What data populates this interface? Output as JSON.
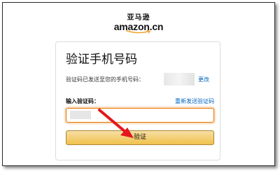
{
  "logo": {
    "cn": "亚马逊",
    "en": "amazon.cn"
  },
  "card": {
    "title": "验证手机号码",
    "sent_text": "验证码已发送至您的手机号码：",
    "change_link": "更改",
    "field_label": "输入验证码：",
    "resend_link": "重新发送验证码",
    "verify_button": "验证"
  },
  "colors": {
    "accent_orange": "#e77600",
    "link_blue": "#0066c0",
    "button_yellow": "#f0c14b",
    "arrow_red": "#e3171c"
  },
  "icons": {
    "arrow": "red-arrow-icon",
    "smile": "amazon-smile-icon"
  }
}
